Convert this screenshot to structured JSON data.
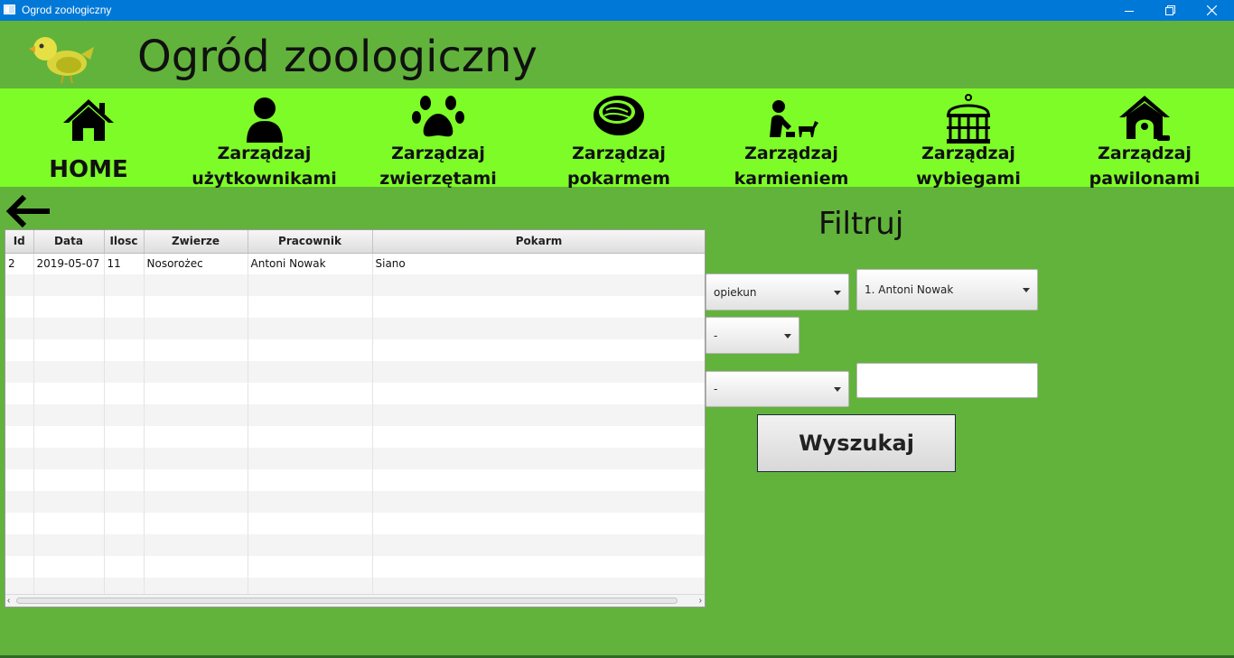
{
  "window": {
    "title": "Ogrod zoologiczny"
  },
  "header": {
    "app_title": "Ogród zoologiczny",
    "logo_icon": "bird-logo-icon"
  },
  "nav": {
    "items": [
      {
        "label": "HOME",
        "icon": "house-icon"
      },
      {
        "label": "Zarządzaj\nużytkownikami",
        "icon": "user-icon"
      },
      {
        "label": "Zarządzaj\nzwierzętami",
        "icon": "paw-icon"
      },
      {
        "label": "Zarządzaj\npokarmem",
        "icon": "meat-icon"
      },
      {
        "label": "Zarządzaj\nkarmieniem",
        "icon": "feeding-icon"
      },
      {
        "label": "Zarządzaj\nwybiegami",
        "icon": "cage-icon"
      },
      {
        "label": "Zarządzaj\npawilonami",
        "icon": "doghouse-icon"
      }
    ]
  },
  "table": {
    "columns": [
      "Id",
      "Data",
      "Ilosc",
      "Zwierze",
      "Pracownik",
      "Pokarm"
    ],
    "rows": [
      [
        "2",
        "2019-05-07",
        "11",
        "Nosorożec",
        "Antoni Nowak",
        "Siano"
      ]
    ],
    "empty_rows": 15
  },
  "filter": {
    "title": "Filtruj",
    "role_select": "opiekun",
    "person_select": "1. Antoni Nowak",
    "select_2": "-",
    "select_3": "-",
    "text_value": "",
    "search_label": "Wyszukaj"
  },
  "colors": {
    "background": "#62b33b",
    "nav_background": "#7dfc27",
    "titlebar": "#0078d7"
  }
}
